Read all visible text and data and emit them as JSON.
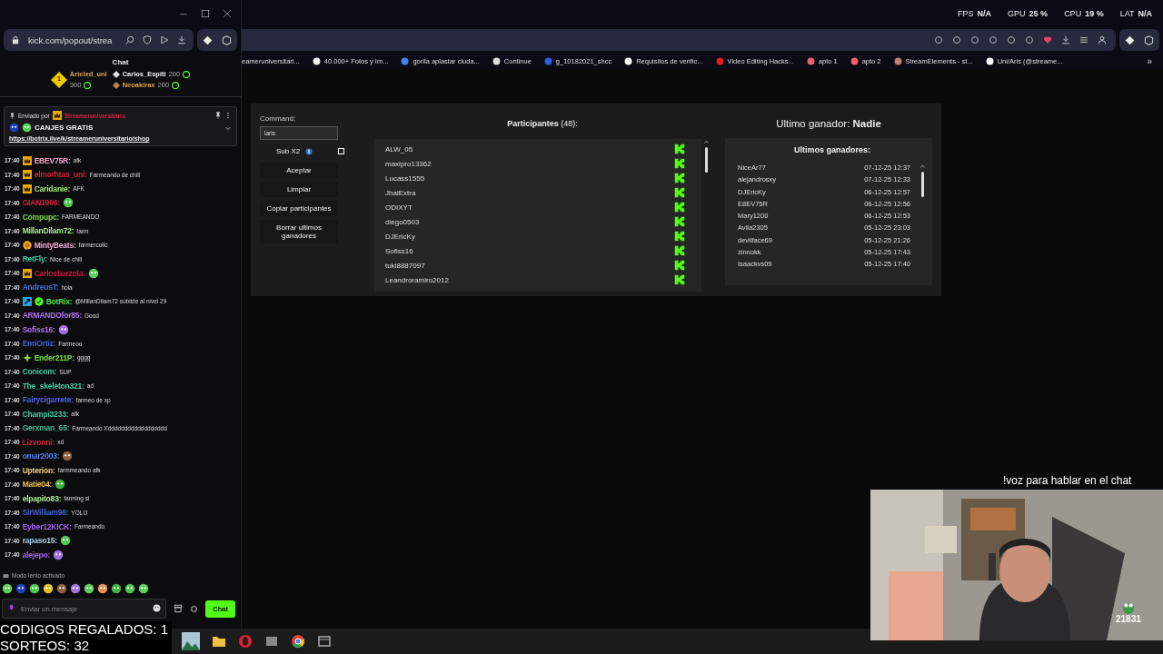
{
  "chat_window": {
    "address": "kick.com/popout/strea",
    "title": "Chat",
    "leaderboard": [
      {
        "rank": "1",
        "name": "Arielxd_uni",
        "points": "300"
      },
      {
        "name": "Carlos_Espiti",
        "points": "200"
      },
      {
        "name": "Neoakirax",
        "points": "200"
      }
    ],
    "pinned": {
      "label": "Enviado por",
      "sender": "Streameruniversitario",
      "title": "CANJES GRATIS",
      "link": "https://botrix.live/k/streameruniversitario/shop"
    },
    "messages": [
      {
        "time": "17:40",
        "badges": [
          {
            "kind": "crown"
          }
        ],
        "user": "EBEV75R:",
        "color": "#f0a0c8",
        "text": "afk"
      },
      {
        "time": "17:40",
        "badges": [
          {
            "kind": "crown"
          }
        ],
        "user": "elmorhtas_uni:",
        "color": "#d0203a",
        "text": "Farmeando de chill"
      },
      {
        "time": "17:40",
        "badges": [
          {
            "kind": "crown"
          }
        ],
        "user": "Caridanie:",
        "color": "#9ce870",
        "text": "AFK"
      },
      {
        "time": "17:40",
        "user": "GIAN1906:",
        "color": "#d0203a",
        "emote": true
      },
      {
        "time": "17:40",
        "user": "Compupc:",
        "color": "#7cd84a",
        "text": "FARMEANDO"
      },
      {
        "time": "17:40",
        "user": "MillanDilam72:",
        "color": "#a8e890",
        "text": "farm"
      },
      {
        "time": "17:40",
        "badges": [
          {
            "kind": "coin"
          }
        ],
        "user": "MintyBeats:",
        "color": "#f0a8d0",
        "text": "farmercolic"
      },
      {
        "time": "17:40",
        "user": "RetFly:",
        "color": "#40c8a0",
        "text": "Nice de chill"
      },
      {
        "time": "17:40",
        "badges": [
          {
            "kind": "crown"
          }
        ],
        "user": "Carlosbarzola:",
        "color": "#c0183a",
        "emote": true
      },
      {
        "time": "17:40",
        "user": "AndreusT:",
        "color": "#4070e0",
        "text": "hola"
      },
      {
        "time": "17:40",
        "badges": [
          {
            "kind": "bot"
          },
          {
            "kind": "verified"
          }
        ],
        "user": "BotRix:",
        "color": "#50e050",
        "text": "@MillanDilam72 subiste al nivel 29"
      },
      {
        "time": "17:40",
        "user": "ARMANDOfor85:",
        "color": "#b070f0",
        "text": "Good"
      },
      {
        "time": "17:40",
        "user": "Sofiss16:",
        "color": "#b070f0",
        "emote": true
      },
      {
        "time": "17:40",
        "user": "EnriOrtiz:",
        "color": "#4060d0",
        "text": "Farmeoo"
      },
      {
        "time": "17:40",
        "badges": [
          {
            "kind": "gem"
          }
        ],
        "user": "Ender211P:",
        "color": "#70e040",
        "text": "gggg"
      },
      {
        "time": "17:40",
        "user": "Conicom:",
        "color": "#40c8a0",
        "text": "SUP"
      },
      {
        "time": "17:40",
        "user": "The_skeleton321:",
        "color": "#40c8a0",
        "text": "ad"
      },
      {
        "time": "17:40",
        "user": "Fairycigarrete:",
        "color": "#5060e0",
        "text": "farmeo de xp"
      },
      {
        "time": "17:40",
        "user": "Champi3233:",
        "color": "#40c8a0",
        "text": "afk"
      },
      {
        "time": "17:40",
        "user": "Gerxman_65:",
        "color": "#3fb890",
        "text": "Farmeando Xdddddddddddddddddd"
      },
      {
        "time": "17:40",
        "user": "Lizvonni:",
        "color": "#d0203a",
        "text": "xd"
      },
      {
        "time": "17:40",
        "user": "omar2003:",
        "color": "#5080f0",
        "emote": true
      },
      {
        "time": "17:40",
        "user": "Upterion:",
        "color": "#f0c880",
        "text": "farmmeando afk"
      },
      {
        "time": "17:40",
        "user": "Matie04:",
        "color": "#f0c050",
        "emote": true
      },
      {
        "time": "17:40",
        "user": "elpapito83:",
        "color": "#a8e890",
        "text": "farming si"
      },
      {
        "time": "17:40",
        "user": "SirWilliam96:",
        "color": "#4060d0",
        "text": "YOLO"
      },
      {
        "time": "17:40",
        "user": "Eyber12KICK:",
        "color": "#a060f0",
        "text": "Farmeando"
      },
      {
        "time": "17:40",
        "user": "rapaso15:",
        "color": "#a8d0f0",
        "emote": true
      },
      {
        "time": "17:40",
        "user": "alejepo:",
        "color": "#a060f0",
        "emote": true
      }
    ],
    "slow_mode": "Modo lento activado",
    "input": {
      "placeholder": "Enviar un mensaje"
    },
    "send_button": "Chat"
  },
  "browser": {
    "stats": [
      {
        "label": "FPS",
        "value": "N/A"
      },
      {
        "label": "GPU",
        "value": "25 %"
      },
      {
        "label": "CPU",
        "value": "19 %"
      },
      {
        "label": "LAT",
        "value": "N/A"
      }
    ],
    "bookmarks": [
      "eameruniversitari...",
      "40.000+ Fotos y Im...",
      "gorila aplastar ciuda...",
      "Continue",
      "g_10182021_shcc",
      "Requisitos de verific...",
      "Video Editing Hacks...",
      "apto 1",
      "apto 2",
      "StreamElements - st...",
      "Uni/Aris (@streame..."
    ],
    "bookmarks_more": "»"
  },
  "raffle": {
    "command_label": "Command:",
    "command_value": "laris",
    "sub_x2": {
      "label": "Sub X2",
      "checked": false
    },
    "buttons": [
      "Aceptar",
      "Limpiar",
      "Copiar participantes",
      "Borrar ultimos ganadores"
    ],
    "participants_title": "Participantes",
    "participants_count": "(48):",
    "participants": [
      "ALW_05",
      "maxipro13362",
      "Lucass1555",
      "JhalExtra",
      "ODIXYT",
      "diego0503",
      "DJEricKy",
      "Sofiss16",
      "tuki8887097",
      "Leandroramiro2012"
    ],
    "last_winner_label": "Ultimo ganador:",
    "last_winner": "Nadie",
    "winners_title": "Ultimos ganadores:",
    "winners": [
      {
        "name": "NiceAr77",
        "date": "07-12-25 12:37"
      },
      {
        "name": "alejandrosxy",
        "date": "07-12-25 12:33"
      },
      {
        "name": "DJEricKy",
        "date": "06-12-25 12:57"
      },
      {
        "name": "E8EV75R",
        "date": "06-12-25 12:56"
      },
      {
        "name": "Mary1200",
        "date": "06-12-25 12:53"
      },
      {
        "name": "Avila2305",
        "date": "05-12-25 23:03"
      },
      {
        "name": "devilface69",
        "date": "05-12-25 21:26"
      },
      {
        "name": "zinnokk",
        "date": "05-12-25 17:43"
      },
      {
        "name": "Isaackvs09",
        "date": "05-12-25 17:40"
      }
    ]
  },
  "overlay": {
    "voice_hint": "!voz para hablar en el chat",
    "counter": "21831",
    "stats": [
      "CODIGOS REGALADOS: 1",
      "SORTEOS: 32"
    ]
  }
}
